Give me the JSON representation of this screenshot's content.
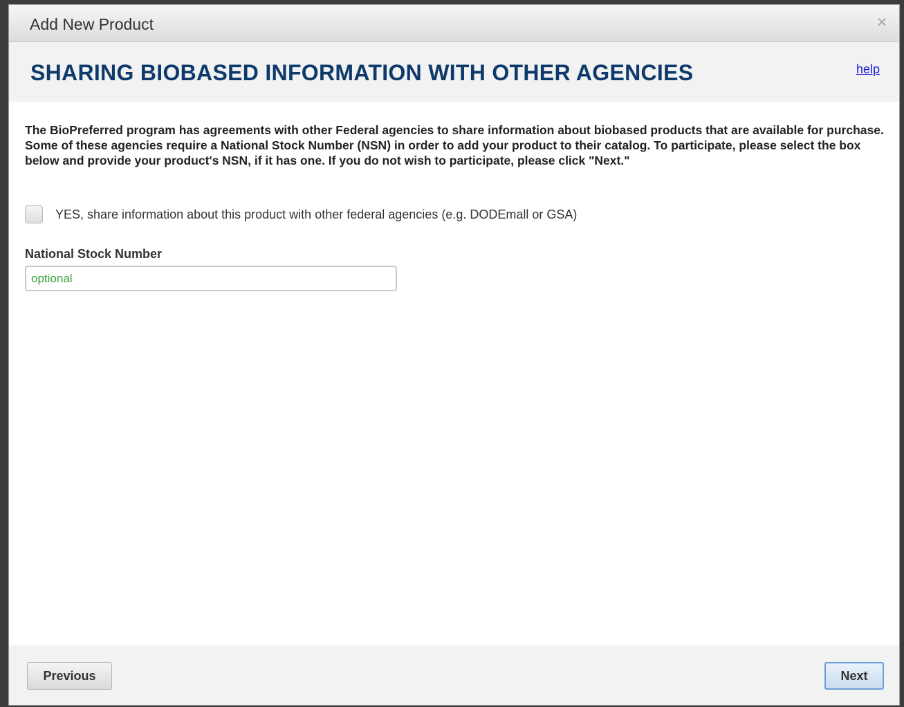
{
  "dialog": {
    "title": "Add New Product",
    "close_icon": "close-icon"
  },
  "header": {
    "section_title": "SHARING BIOBASED INFORMATION WITH OTHER AGENCIES",
    "help_label": "help"
  },
  "content": {
    "intro": "The BioPreferred program has agreements with other Federal agencies to share information about biobased products that are available for purchase. Some of these agencies require a National Stock Number (NSN) in order to add your product to their catalog. To participate, please select the box below and provide your product's NSN, if it has one. If you do not wish to participate, please click \"Next.\"",
    "share_checkbox": {
      "label": "YES, share information about this product with other federal agencies (e.g. DODEmall or GSA)",
      "checked": false
    },
    "nsn": {
      "label": "National Stock Number",
      "value": "",
      "placeholder": "optional"
    }
  },
  "footer": {
    "previous_label": "Previous",
    "next_label": "Next"
  },
  "colors": {
    "title": "#0d3a6b",
    "link": "#1a1ad6",
    "placeholder": "#3aa23a",
    "next_border": "#6a9fd6"
  }
}
